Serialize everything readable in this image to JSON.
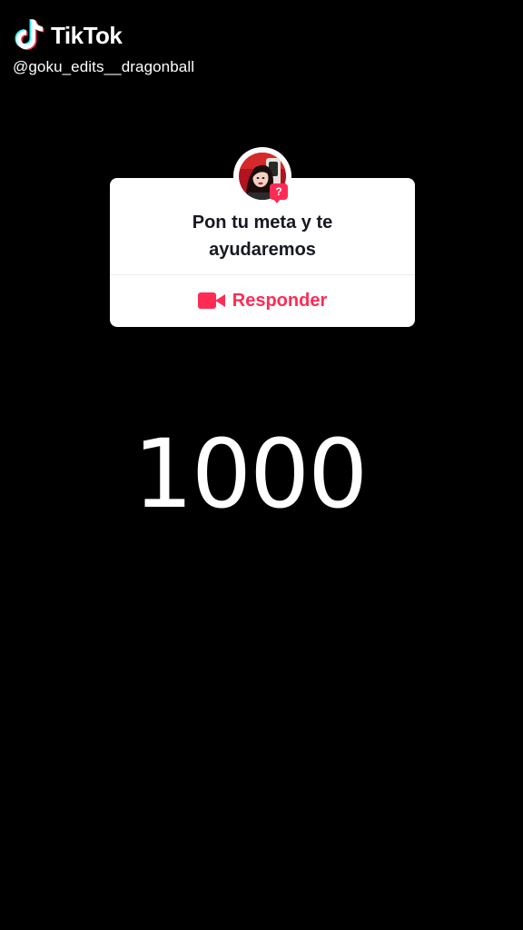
{
  "watermark": {
    "brand": "TikTok",
    "username": "@goku_edits__dragonball",
    "logo_icon": "tiktok-logo-icon"
  },
  "question_card": {
    "avatar_icon": "avatar-photo",
    "badge_text": "?",
    "question_lines": [
      "Pon tu meta y te",
      "ayudaremos"
    ],
    "reply_icon": "video-camera-icon",
    "reply_label": "Responder"
  },
  "main": {
    "number": "1000"
  },
  "colors": {
    "background": "#000000",
    "accent": "#fe2c55",
    "card": "#ffffff",
    "text_dark": "#161823"
  }
}
